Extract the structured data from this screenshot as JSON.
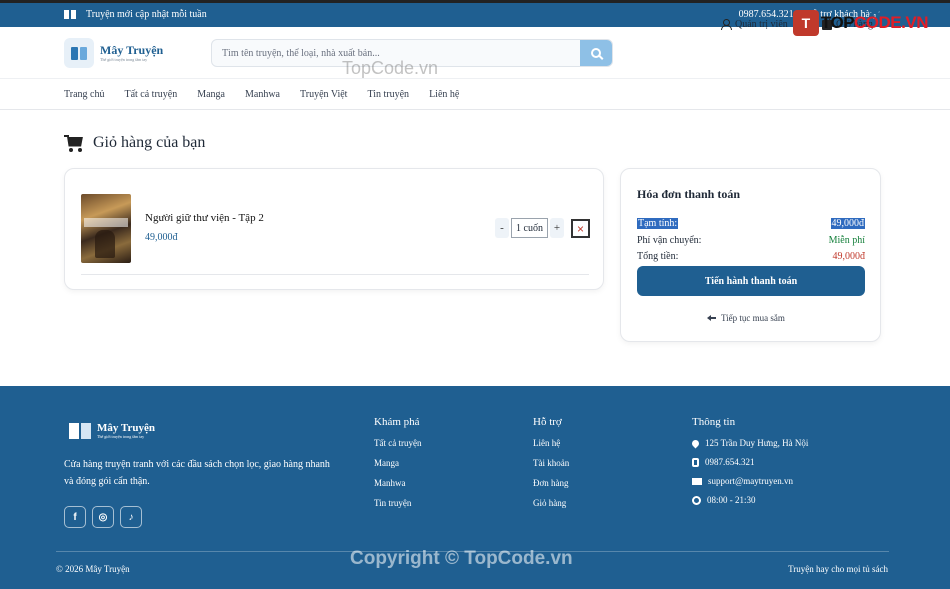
{
  "topbar": {
    "announcement": "Truyện mới cập nhật mỗi tuần",
    "phone": "0987.654.321",
    "support": "Hỗ trợ khách hàng"
  },
  "watermarks": {
    "logo_mark": "T",
    "logo_text_top": "TOP",
    "logo_text_code": "CODE.VN",
    "center": "TopCode.vn",
    "bottom": "Copyright © TopCode.vn"
  },
  "header": {
    "brand": "Mây Truyện",
    "tagline": "Thế giới truyện trong tầm tay",
    "search_placeholder": "Tìm tên truyện, thể loại, nhà xuất bản...",
    "user_label": "Quản trị viên",
    "cart_label": "Giỏ hàng",
    "cart_count": "1"
  },
  "nav": {
    "items": [
      "Trang chủ",
      "Tất cả truyện",
      "Manga",
      "Manhwa",
      "Truyện Việt",
      "Tin truyện",
      "Liên hệ"
    ]
  },
  "page": {
    "title": "Giỏ hàng của bạn"
  },
  "cart": {
    "items": [
      {
        "name": "Người giữ thư viện - Tập 2",
        "price": "49,000đ",
        "quantity": "1 cuốn",
        "minus": "-",
        "plus": "+",
        "remove": "×"
      }
    ]
  },
  "invoice": {
    "title": "Hóa đơn thanh toán",
    "subtotal_label": "Tạm tính:",
    "subtotal_value": "49,000đ",
    "shipping_label": "Phí vận chuyển:",
    "shipping_value": "Miễn phí",
    "total_label": "Tổng tiền:",
    "total_value": "49,000đ",
    "checkout_label": "Tiến hành thanh toán",
    "continue_label": "Tiếp tục mua sắm"
  },
  "footer": {
    "brand": "Mây Truyện",
    "tagline": "Thế giới truyện trong tầm tay",
    "description": "Cửa hàng truyện tranh với các đầu sách chọn lọc, giao hàng nhanh và đóng gói cẩn thận.",
    "socials": [
      "f",
      "◎",
      "♪"
    ],
    "explore": {
      "title": "Khám phá",
      "links": [
        "Tất cả truyện",
        "Manga",
        "Manhwa",
        "Tin truyện"
      ]
    },
    "support": {
      "title": "Hỗ trợ",
      "links": [
        "Liên hệ",
        "Tài khoản",
        "Đơn hàng",
        "Giỏ hàng"
      ]
    },
    "info": {
      "title": "Thông tin",
      "address": "125 Trần Duy Hưng, Hà Nội",
      "phone": "0987.654.321",
      "email": "support@maytruyen.vn",
      "hours": "08:00 - 21:30"
    },
    "copyright": "© 2026 Mây Truyện",
    "slogan": "Truyện hay cho mọi tủ sách"
  }
}
